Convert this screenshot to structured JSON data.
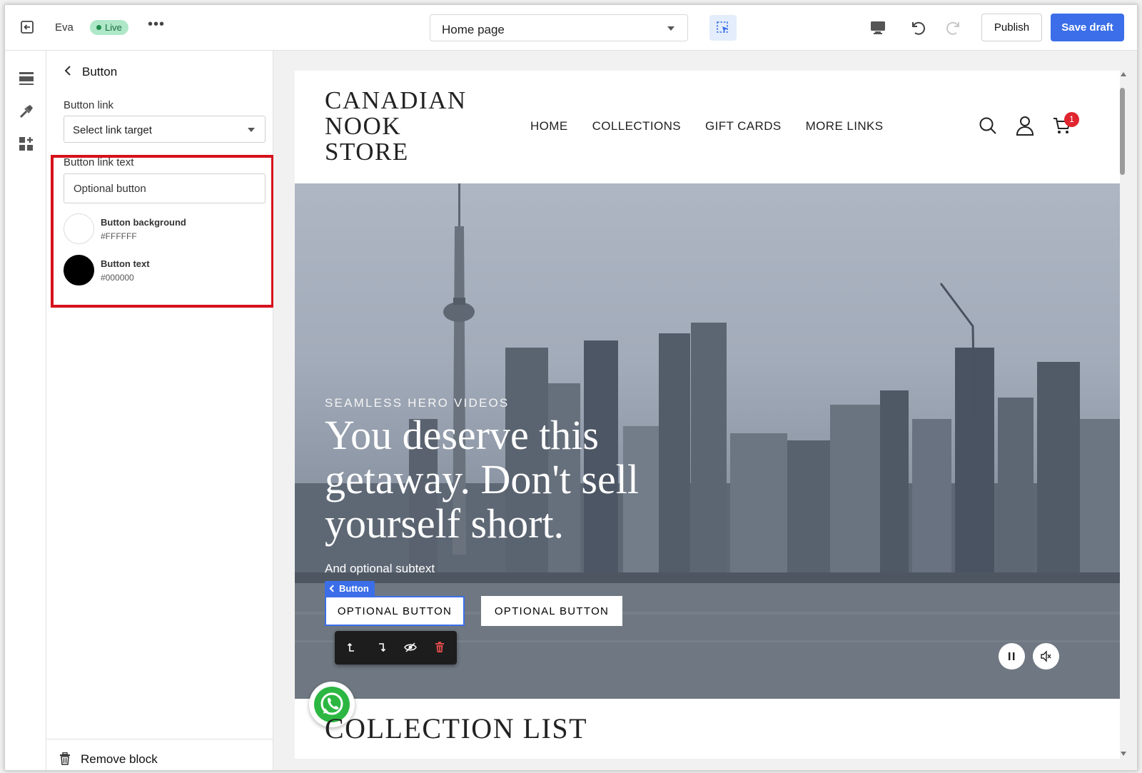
{
  "topbar": {
    "store_name": "Eva",
    "status_badge": "Live",
    "more_label": "•••",
    "page_select": "Home page",
    "publish_label": "Publish",
    "save_label": "Save draft"
  },
  "panel": {
    "title": "Button",
    "link_label": "Button link",
    "link_select": "Select link target",
    "link_text_label": "Button link text",
    "link_text_value": "Optional button",
    "bg_color": {
      "name": "Button background",
      "hex": "#FFFFFF"
    },
    "text_color": {
      "name": "Button text",
      "hex": "#000000"
    },
    "remove_label": "Remove block"
  },
  "site": {
    "logo_lines": [
      "CANADIAN",
      "NOOK",
      "STORE"
    ],
    "nav": [
      "HOME",
      "COLLECTIONS",
      "GIFT CARDS",
      "MORE LINKS"
    ],
    "cart_count": "1",
    "hero": {
      "eyebrow": "SEAMLESS HERO VIDEOS",
      "heading": "You deserve this getaway. Don't sell yourself short.",
      "subtext": "And optional subtext",
      "selection_tag": "Button",
      "button_1": "OPTIONAL BUTTON",
      "button_2": "OPTIONAL BUTTON"
    },
    "collection_title": "COLLECTION LIST"
  },
  "colors": {
    "accent": "#3b6ee8",
    "highlight": "#d6111b",
    "live_badge": "#aee8c8",
    "cart_badge": "#e0252f"
  }
}
